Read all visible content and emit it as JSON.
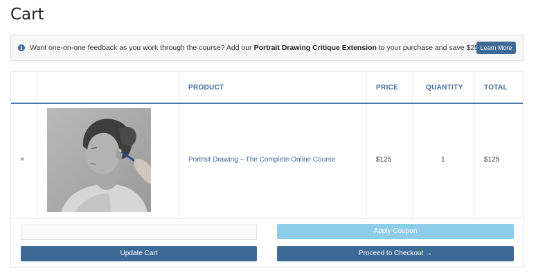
{
  "page": {
    "title": "Cart"
  },
  "notice": {
    "icon": "info-icon",
    "text_before": "Want one-on-one feedback as you work through the course? Add our ",
    "text_bold": "Portrait Drawing Critique Extension",
    "text_after": " to your purchase and save $25.",
    "button_label": "Learn More"
  },
  "table": {
    "headers": {
      "product": "PRODUCT",
      "price": "PRICE",
      "quantity": "QUANTITY",
      "total": "TOTAL"
    },
    "rows": [
      {
        "remove": "×",
        "thumbnail": "portrait-drawing-photo",
        "product": "Portrait Drawing – The Complete Online Course",
        "price": "$125",
        "quantity": "1",
        "total": "$125"
      }
    ]
  },
  "actions": {
    "coupon_placeholder": "",
    "apply_coupon": "Apply Coupon",
    "update_cart": "Update Cart",
    "proceed_checkout": "Proceed to Checkout →"
  },
  "colors": {
    "accent": "#3e6a98",
    "apply_button": "#8ecde9",
    "notice_bg": "#f7f7f7"
  }
}
